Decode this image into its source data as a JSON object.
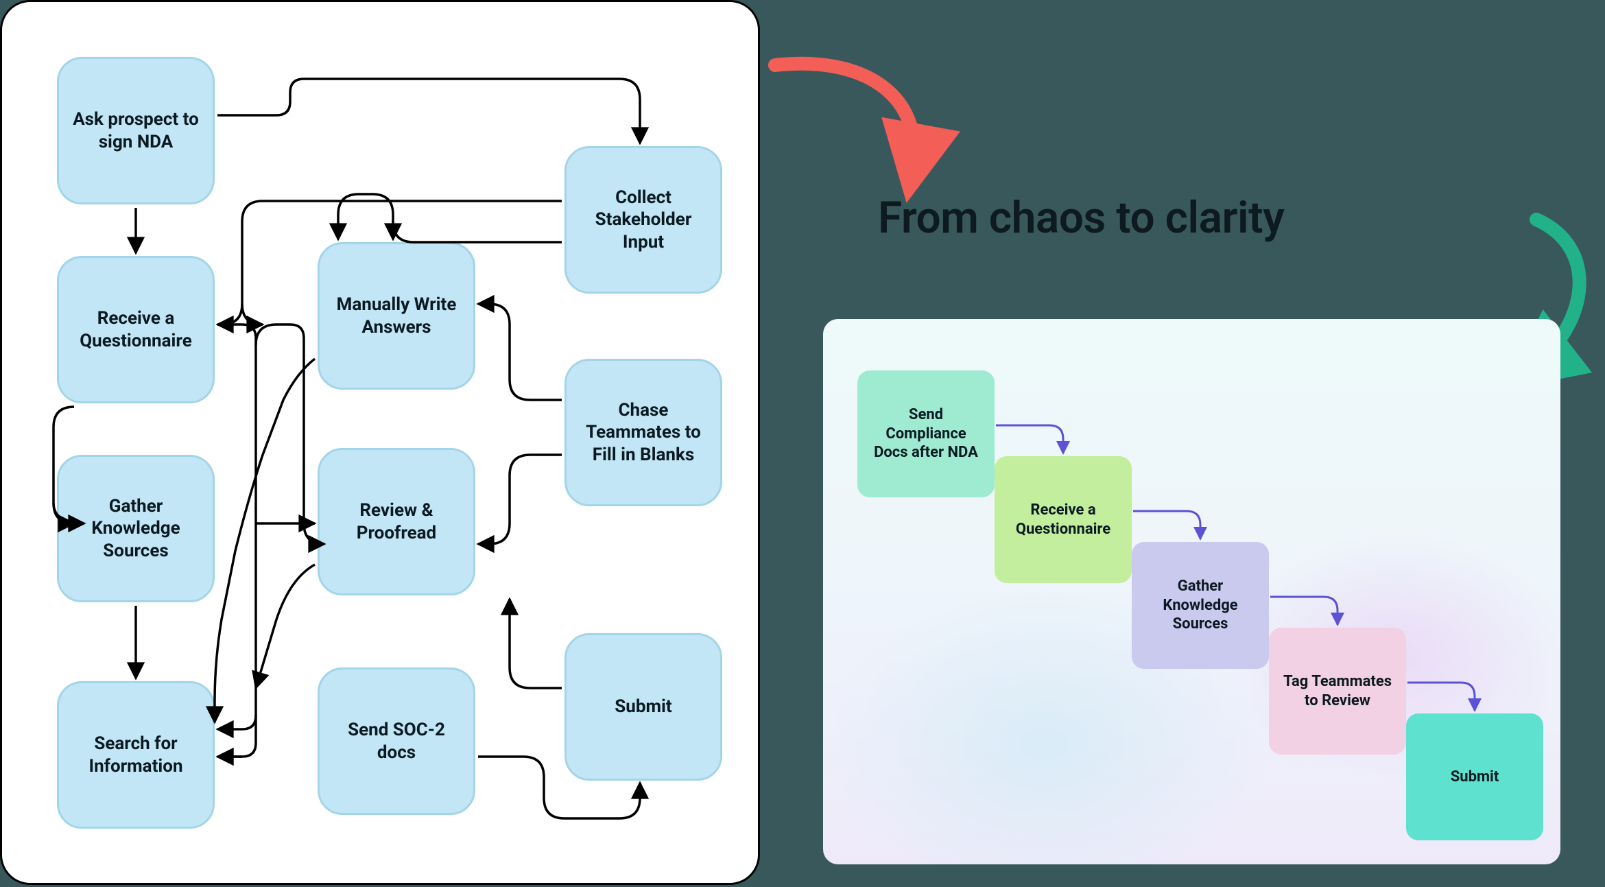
{
  "headline": "From chaos to clarity",
  "left_panel": {
    "nodes": [
      {
        "id": "ask_nda",
        "label": "Ask prospect to sign NDA"
      },
      {
        "id": "receive_q",
        "label": "Receive a Questionnaire"
      },
      {
        "id": "gather_sources",
        "label": "Gather Knowledge Sources"
      },
      {
        "id": "search_info",
        "label": "Search for Information"
      },
      {
        "id": "manual_write",
        "label": "Manually Write Answers"
      },
      {
        "id": "review_proof",
        "label": "Review & Proofread"
      },
      {
        "id": "send_soc2",
        "label": "Send SOC-2 docs"
      },
      {
        "id": "collect_stake",
        "label": "Collect Stakeholder Input"
      },
      {
        "id": "chase_team",
        "label": "Chase Teammates to Fill in Blanks"
      },
      {
        "id": "submit",
        "label": "Submit"
      }
    ],
    "edges": [
      [
        "ask_nda",
        "receive_q"
      ],
      [
        "ask_nda",
        "collect_stake"
      ],
      [
        "receive_q",
        "manual_write"
      ],
      [
        "receive_q",
        "gather_sources"
      ],
      [
        "receive_q",
        "search_info"
      ],
      [
        "collect_stake",
        "manual_write"
      ],
      [
        "collect_stake",
        "receive_q"
      ],
      [
        "gather_sources",
        "search_info"
      ],
      [
        "gather_sources",
        "review_proof"
      ],
      [
        "manual_write",
        "search_info"
      ],
      [
        "review_proof",
        "search_info"
      ],
      [
        "chase_team",
        "manual_write"
      ],
      [
        "chase_team",
        "review_proof"
      ],
      [
        "send_soc2",
        "submit"
      ],
      [
        "submit",
        "review_proof"
      ]
    ]
  },
  "right_panel": {
    "nodes": [
      {
        "id": "send_docs",
        "label": "Send Compliance Docs after NDA",
        "color": "teal"
      },
      {
        "id": "receive_q2",
        "label": "Receive a Questionnaire",
        "color": "green"
      },
      {
        "id": "gather2",
        "label": "Gather Knowledge Sources",
        "color": "purple"
      },
      {
        "id": "tag_team",
        "label": "Tag Teammates to Review",
        "color": "pink"
      },
      {
        "id": "submit2",
        "label": "Submit",
        "color": "cyan"
      }
    ],
    "edges": [
      [
        "send_docs",
        "receive_q2"
      ],
      [
        "receive_q2",
        "gather2"
      ],
      [
        "gather2",
        "tag_team"
      ],
      [
        "tag_team",
        "submit2"
      ]
    ]
  },
  "transition_arrows": [
    {
      "name": "chaos-arrow",
      "color": "#f35e56",
      "from": "left_panel",
      "to": "headline"
    },
    {
      "name": "clarity-arrow",
      "color": "#22b28a",
      "from": "headline",
      "to": "right_panel"
    }
  ]
}
